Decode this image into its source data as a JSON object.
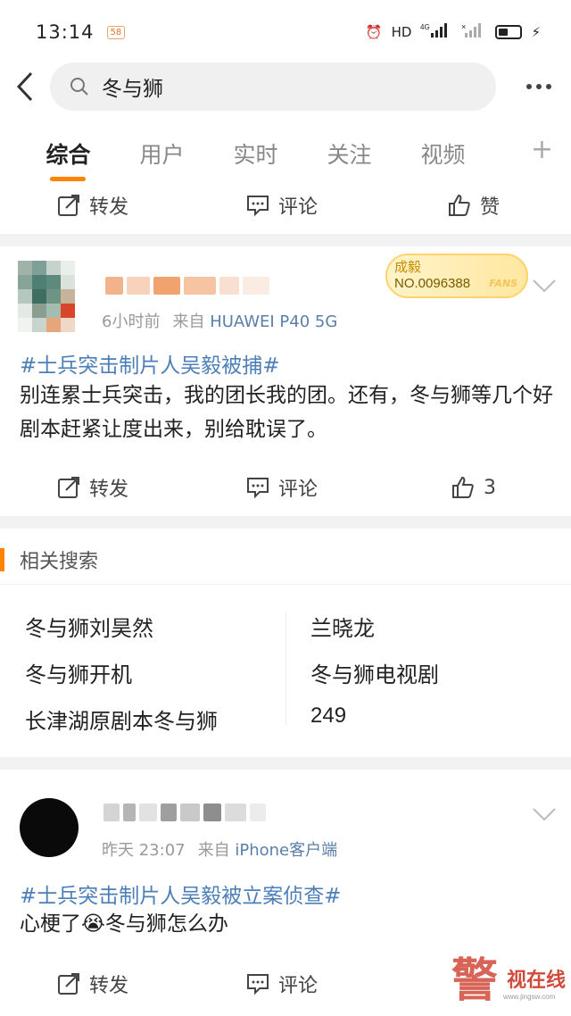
{
  "status_bar": {
    "time": "13:14",
    "app_badge": "58",
    "network": "HD",
    "signal": "4G"
  },
  "search": {
    "query": "冬与狮"
  },
  "tabs": [
    {
      "label": "综合",
      "active": true
    },
    {
      "label": "用户",
      "active": false
    },
    {
      "label": "实时",
      "active": false
    },
    {
      "label": "关注",
      "active": false
    },
    {
      "label": "视频",
      "active": false
    }
  ],
  "tab_add": "+",
  "top_actions": {
    "repost": "转发",
    "comment": "评论",
    "like": "赞"
  },
  "post1": {
    "time": "6小时前",
    "source_prefix": "来自",
    "source": "HUAWEI P40 5G",
    "fan_badge_name": "成毅",
    "fan_badge_no": "NO.0096388",
    "fan_badge_tag": "FANS",
    "topic": "#士兵突击制片人吴毅被捕#",
    "body": "别连累士兵突击，我的团长我的团。还有，冬与狮等几个好剧本赶紧让度出来，别给耽误了。",
    "repost": "转发",
    "comment": "评论",
    "like_count": "3"
  },
  "related": {
    "title": "相关搜索",
    "items": [
      "冬与狮刘昊然",
      "兰晓龙",
      "冬与狮开机",
      "冬与狮电视剧",
      "长津湖原剧本冬与狮",
      "249"
    ]
  },
  "post2": {
    "time": "昨天 23:07",
    "source_prefix": "来自",
    "source": "iPhone客户端",
    "topic": "#士兵突击制片人吴毅被立案侦查#",
    "body_pre": "心梗了",
    "emoji": "😭",
    "body_post": "冬与狮怎么办",
    "repost": "转发",
    "comment": "评论"
  },
  "watermark": {
    "glyph": "警",
    "text": "视在线",
    "sub": "www.jingsw.com"
  },
  "colors": {
    "accent": "#ff8200",
    "link": "#4c7fb8",
    "source": "#5b7fa8"
  }
}
